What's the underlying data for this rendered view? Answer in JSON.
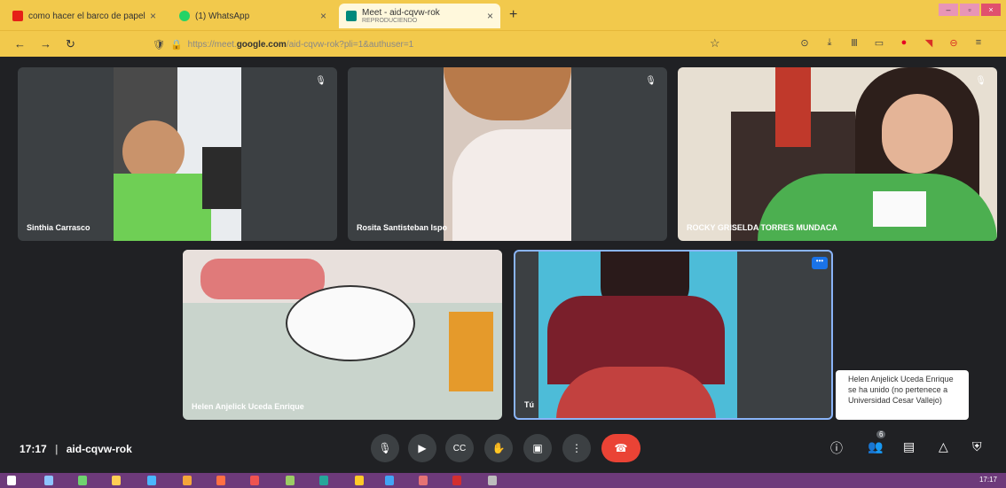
{
  "browser": {
    "tabs": [
      {
        "label": "como hacer el barco de papel",
        "close": "×"
      },
      {
        "label": "(1) WhatsApp",
        "close": "×"
      },
      {
        "label": "Meet - aid-cqvw-rok",
        "sublabel": "REPRODUCIENDO",
        "close": "×"
      }
    ],
    "new_tab": "+",
    "window": {
      "min": "–",
      "max": "▫",
      "close": "×"
    },
    "back": "←",
    "forward": "→",
    "reload": "↻",
    "url_prefix": "https://meet.",
    "url_host": "google.com",
    "url_path": "/aid-cqvw-rok?pli=1&authuser=1",
    "bookmark": "☆",
    "tool_icons": [
      "⊙",
      "⤓",
      "Ⅲ",
      "▭",
      "●",
      "◥",
      "⊖",
      "≡"
    ]
  },
  "meet": {
    "participants": [
      {
        "name": "Sinthia Carrasco"
      },
      {
        "name": "Rosita Santisteban Ispo"
      },
      {
        "name": "ROCKY GRISELDA TORRES MUNDACA"
      },
      {
        "name": "Helen Anjelick Uceda Enrique"
      },
      {
        "name": "Tú"
      }
    ],
    "more_options": "•••",
    "mic_muted": "🎙",
    "toast": "Helen Anjelick Uceda Enrique se ha unido (no pertenece a Universidad Cesar Vallejo)",
    "time": "17:17",
    "separator": "|",
    "meeting_code": "aid-cqvw-rok",
    "controls": {
      "mic": "🎙",
      "camera": "▶",
      "captions": "CC",
      "hand": "✋",
      "present": "▣",
      "more": "⋮",
      "end": "☎"
    },
    "right": {
      "info": "ⓘ",
      "people": "👥",
      "people_count": "6",
      "chat": "▤",
      "activities": "△",
      "lock": "⛨"
    }
  },
  "taskbar": {
    "time": "17:17"
  },
  "colors": {
    "browser_chrome": "#f2c94c",
    "meet_bg": "#202124",
    "tile_bg": "#3c4043",
    "end_call": "#ea4335",
    "taskbar": "#6d3a7a"
  }
}
